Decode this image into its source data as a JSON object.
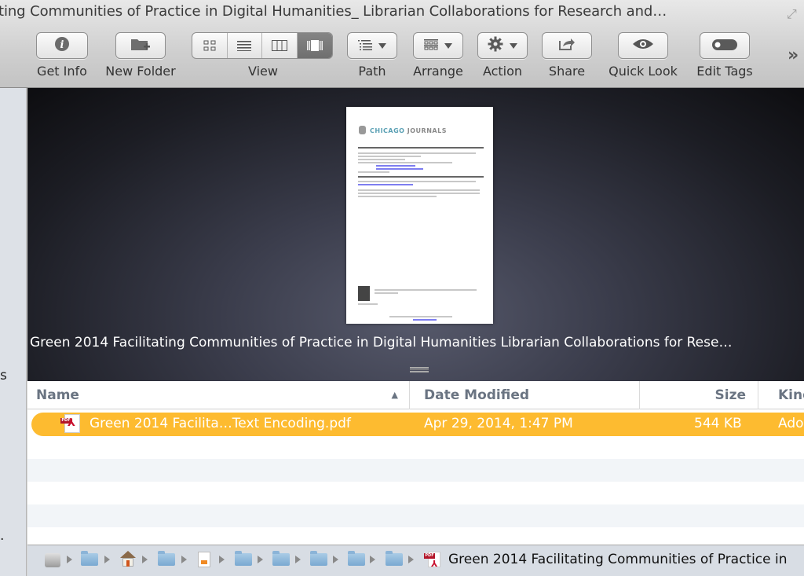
{
  "window": {
    "title": "ting Communities of Practice in Digital Humanities_ Librarian Collaborations for Research and…"
  },
  "toolbar": {
    "items": [
      {
        "label": "Get Info",
        "icon": "info-icon"
      },
      {
        "label": "New Folder",
        "icon": "new-folder-icon"
      },
      {
        "label": "View",
        "icon": "view-segmented",
        "segments": [
          "icon-view",
          "list-view",
          "column-view",
          "cover-flow-view"
        ],
        "active_segment": "cover-flow-view"
      },
      {
        "label": "Path",
        "icon": "path-menu-icon"
      },
      {
        "label": "Arrange",
        "icon": "arrange-grid-icon"
      },
      {
        "label": "Action",
        "icon": "gear-icon"
      },
      {
        "label": "Share",
        "icon": "share-icon"
      },
      {
        "label": "Quick Look",
        "icon": "eye-icon"
      },
      {
        "label": "Edit Tags",
        "icon": "tag-toggle-icon"
      }
    ],
    "overflow": "»"
  },
  "sidebar": {
    "fragments": [
      "s",
      "."
    ]
  },
  "preview": {
    "thumbnail_header": {
      "brand_left": "CHICAGO",
      "brand_right": "JOURNALS"
    },
    "title": "Green 2014 Facilitating Communities of Practice in Digital Humanities Librarian Collaborations for Rese…"
  },
  "file_list": {
    "columns": [
      {
        "label": "Name",
        "sort": "ascending",
        "sort_glyph": "▲"
      },
      {
        "label": "Date Modified"
      },
      {
        "label": "Size"
      },
      {
        "label": "Kind"
      }
    ],
    "rows": [
      {
        "name": "Green 2014 Facilita…Text Encoding.pdf",
        "date_modified": "Apr 29, 2014, 1:47 PM",
        "size": "544 KB",
        "kind": "Ado",
        "selected": true,
        "icon": "pdf-icon"
      }
    ],
    "selection_color": "#fdbb30"
  },
  "path_bar": {
    "crumbs": [
      "hard-disk-icon",
      "user-folder-icon",
      "home-icon",
      "documents-folder-icon",
      "document-icon",
      "folder-icon",
      "folder-icon",
      "folder-icon",
      "folder-icon",
      "folder-icon"
    ],
    "current": "Green 2014 Facilitating Communities of Practice in"
  }
}
